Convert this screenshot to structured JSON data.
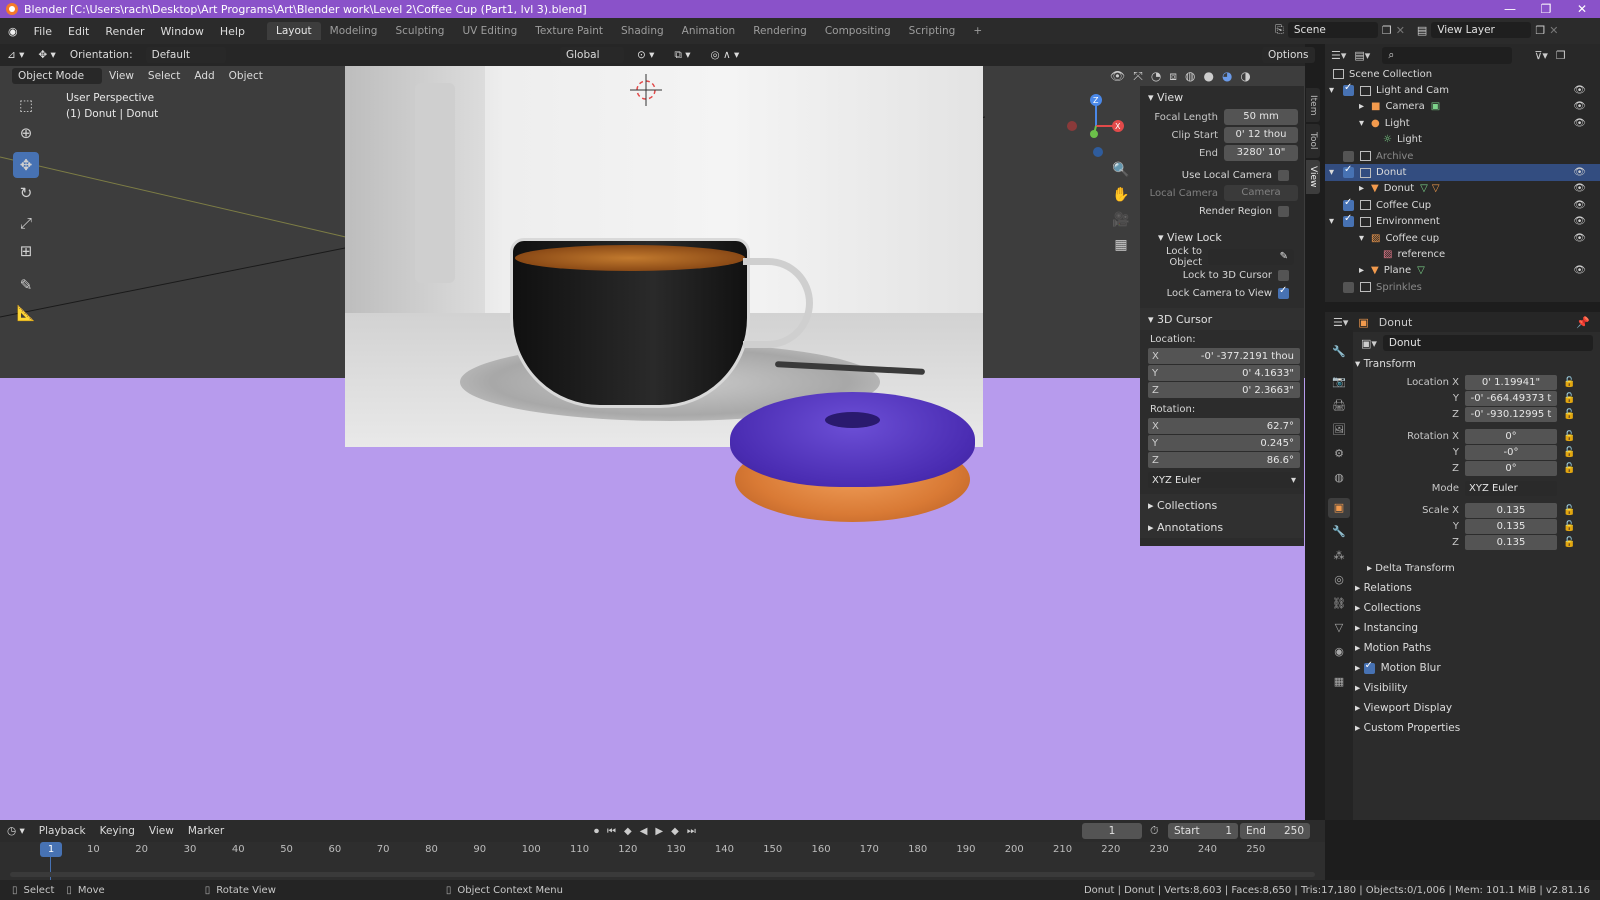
{
  "titlebar": {
    "title": "Blender [C:\\Users\\rach\\Desktop\\Art Programs\\Art\\Blender work\\Level 2\\Coffee Cup (Part1, lvl 3).blend]",
    "minimize": "—",
    "maximize": "❐",
    "close": "✕"
  },
  "menubar": {
    "menus": [
      "File",
      "Edit",
      "Render",
      "Window",
      "Help"
    ],
    "workspaces": [
      "Layout",
      "Modeling",
      "Sculpting",
      "UV Editing",
      "Texture Paint",
      "Shading",
      "Animation",
      "Rendering",
      "Compositing",
      "Scripting"
    ],
    "active_workspace": "Layout",
    "add_tab": "+",
    "scene_label": "Scene",
    "view_layer_label": "View Layer"
  },
  "viewport_header": {
    "orientation_label": "Orientation:",
    "orientation_value": "Default",
    "transform_space": "Global",
    "options": "Options"
  },
  "viewport_header2": {
    "mode": "Object Mode",
    "menus": [
      "View",
      "Select",
      "Add",
      "Object"
    ]
  },
  "viewport": {
    "perspective": "User Perspective",
    "active_object": "(1) Donut | Donut",
    "floor_color": "#b79bed"
  },
  "npanel": {
    "view_title": "View",
    "focal_length_label": "Focal Length",
    "focal_length": "50 mm",
    "clip_start_label": "Clip Start",
    "clip_start": "0' 12 thou",
    "end_label": "End",
    "clip_end": "3280' 10\"",
    "use_local_camera": "Use Local Camera",
    "local_camera_label": "Local Camera",
    "local_camera_value": "Camera",
    "render_region": "Render Region",
    "view_lock_title": "View Lock",
    "lock_to_object": "Lock to Object",
    "lock_to_cursor": "Lock to 3D Cursor",
    "lock_camera_to_view": "Lock Camera to View",
    "cursor_title": "3D Cursor",
    "location_label": "Location:",
    "loc_x": "-0' -377.2191 thou",
    "loc_y": "0' 4.1633\"",
    "loc_z": "0' 2.3663\"",
    "rotation_label": "Rotation:",
    "rot_x": "62.7°",
    "rot_y": "0.245°",
    "rot_z": "86.6°",
    "rot_mode": "XYZ Euler",
    "collections": "Collections",
    "annotations": "Annotations",
    "tabs": [
      "Item",
      "Tool",
      "View"
    ]
  },
  "outliner": {
    "root": "Scene Collection",
    "rows": [
      {
        "label": "Light and Cam",
        "indent": 1
      },
      {
        "label": "Camera",
        "indent": 2
      },
      {
        "label": "Light",
        "indent": 2
      },
      {
        "label": "Light",
        "indent": 3
      },
      {
        "label": "Archive",
        "indent": 1
      },
      {
        "label": "Donut",
        "indent": 1
      },
      {
        "label": "Donut",
        "indent": 2
      },
      {
        "label": "Coffee Cup",
        "indent": 1
      },
      {
        "label": "Environment",
        "indent": 1
      },
      {
        "label": "Coffee cup",
        "indent": 2
      },
      {
        "label": "reference",
        "indent": 3
      },
      {
        "label": "Plane",
        "indent": 2
      },
      {
        "label": "Sprinkles",
        "indent": 1
      }
    ]
  },
  "properties": {
    "header_object": "Donut",
    "object_name": "Donut",
    "transform_title": "Transform",
    "location_x_label": "Location X",
    "loc_x": "0' 1.19941\"",
    "loc_y": "-0' -664.49373 t",
    "loc_z": "-0' -930.12995 t",
    "rotation_x_label": "Rotation X",
    "rot_x": "0°",
    "rot_y": "-0°",
    "rot_z": "0°",
    "mode_label": "Mode",
    "mode_value": "XYZ Euler",
    "scale_x_label": "Scale X",
    "scale_x": "0.135",
    "scale_y": "0.135",
    "scale_z": "0.135",
    "y_label": "Y",
    "z_label": "Z",
    "delta_transform": "Delta Transform",
    "sections": [
      "Relations",
      "Collections",
      "Instancing",
      "Motion Paths",
      "Motion Blur",
      "Visibility",
      "Viewport Display",
      "Custom Properties"
    ]
  },
  "timeline": {
    "menus": [
      "Playback",
      "Keying",
      "View",
      "Marker"
    ],
    "current_frame": "1",
    "start_label": "Start",
    "start": "1",
    "end_label": "End",
    "end": "250",
    "ticks": [
      "10",
      "20",
      "30",
      "40",
      "50",
      "60",
      "70",
      "80",
      "90",
      "100",
      "110",
      "120",
      "130",
      "140",
      "150",
      "160",
      "170",
      "180",
      "190",
      "200",
      "210",
      "220",
      "230",
      "240",
      "250"
    ],
    "playhead": "1"
  },
  "statusbar": {
    "select": "Select",
    "move": "Move",
    "rotate_view": "Rotate View",
    "context_menu": "Object Context Menu",
    "stats": "Donut | Donut | Verts:8,603 | Faces:8,650 | Tris:17,180 | Objects:0/1,006 | Mem: 101.1 MiB | v2.81.16"
  }
}
